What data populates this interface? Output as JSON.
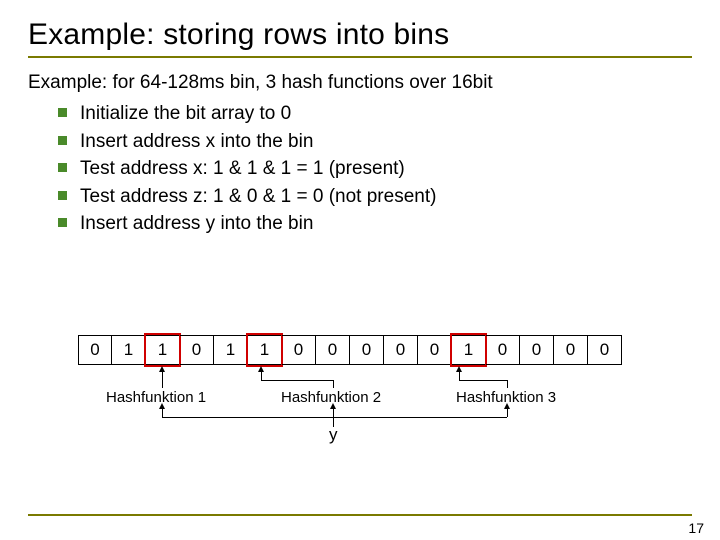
{
  "title": "Example: storing rows into bins",
  "lead": "Example:  for 64-128ms bin, 3 hash functions over 16bit",
  "bullets": [
    "Initialize the bit array to 0",
    "Insert address x into the bin",
    "Test address x: 1 & 1 & 1 = 1 (present)",
    "Test address z: 1 & 0 & 1 = 0 (not present)",
    "Insert address y into the bin"
  ],
  "bitarray": {
    "cells": [
      "0",
      "1",
      "1",
      "0",
      "1",
      "1",
      "0",
      "0",
      "0",
      "0",
      "0",
      "1",
      "0",
      "0",
      "0",
      "0"
    ],
    "highlighted_indices": [
      2,
      5,
      11
    ]
  },
  "hashfn": {
    "hf1": "Hashfunktion 1",
    "hf2": "Hashfunktion 2",
    "hf3": "Hashfunktion 3"
  },
  "y_label": "y",
  "page_number": "17"
}
